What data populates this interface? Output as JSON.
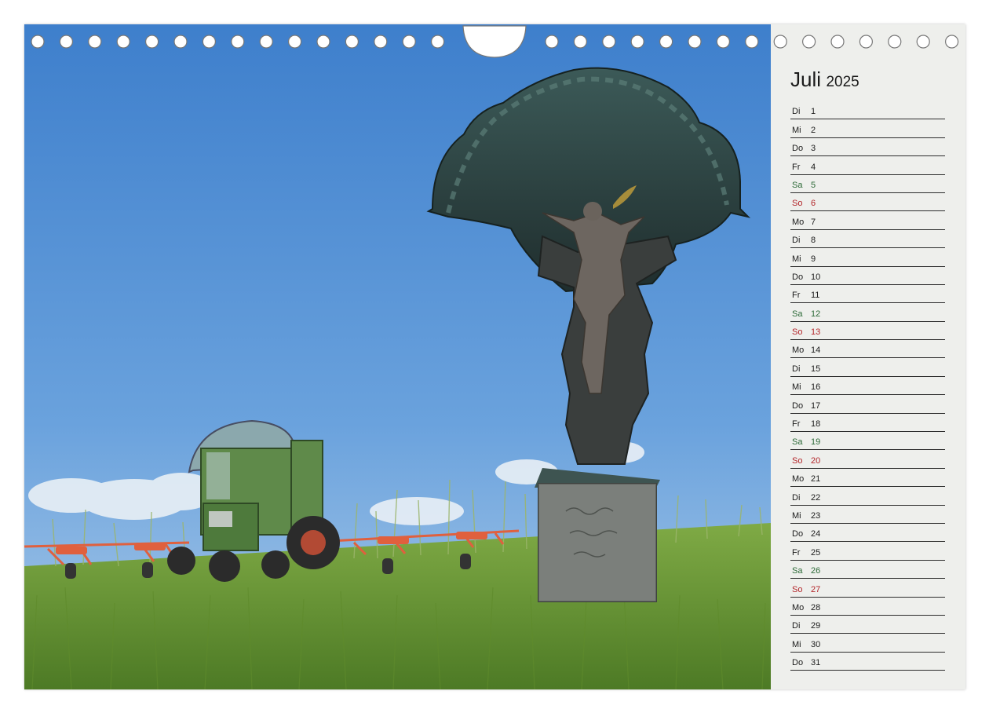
{
  "calendar": {
    "month": "Juli",
    "year": "2025",
    "days": [
      {
        "wd": "Di",
        "d": "1",
        "type": "weekday"
      },
      {
        "wd": "Mi",
        "d": "2",
        "type": "weekday"
      },
      {
        "wd": "Do",
        "d": "3",
        "type": "weekday"
      },
      {
        "wd": "Fr",
        "d": "4",
        "type": "weekday"
      },
      {
        "wd": "Sa",
        "d": "5",
        "type": "sat"
      },
      {
        "wd": "So",
        "d": "6",
        "type": "sun"
      },
      {
        "wd": "Mo",
        "d": "7",
        "type": "weekday"
      },
      {
        "wd": "Di",
        "d": "8",
        "type": "weekday"
      },
      {
        "wd": "Mi",
        "d": "9",
        "type": "weekday"
      },
      {
        "wd": "Do",
        "d": "10",
        "type": "weekday"
      },
      {
        "wd": "Fr",
        "d": "11",
        "type": "weekday"
      },
      {
        "wd": "Sa",
        "d": "12",
        "type": "sat"
      },
      {
        "wd": "So",
        "d": "13",
        "type": "sun"
      },
      {
        "wd": "Mo",
        "d": "14",
        "type": "weekday"
      },
      {
        "wd": "Di",
        "d": "15",
        "type": "weekday"
      },
      {
        "wd": "Mi",
        "d": "16",
        "type": "weekday"
      },
      {
        "wd": "Do",
        "d": "17",
        "type": "weekday"
      },
      {
        "wd": "Fr",
        "d": "18",
        "type": "weekday"
      },
      {
        "wd": "Sa",
        "d": "19",
        "type": "sat"
      },
      {
        "wd": "So",
        "d": "20",
        "type": "sun"
      },
      {
        "wd": "Mo",
        "d": "21",
        "type": "weekday"
      },
      {
        "wd": "Di",
        "d": "22",
        "type": "weekday"
      },
      {
        "wd": "Mi",
        "d": "23",
        "type": "weekday"
      },
      {
        "wd": "Do",
        "d": "24",
        "type": "weekday"
      },
      {
        "wd": "Fr",
        "d": "25",
        "type": "weekday"
      },
      {
        "wd": "Sa",
        "d": "26",
        "type": "sat"
      },
      {
        "wd": "So",
        "d": "27",
        "type": "sun"
      },
      {
        "wd": "Mo",
        "d": "28",
        "type": "weekday"
      },
      {
        "wd": "Di",
        "d": "29",
        "type": "weekday"
      },
      {
        "wd": "Mi",
        "d": "30",
        "type": "weekday"
      },
      {
        "wd": "Do",
        "d": "31",
        "type": "weekday"
      }
    ]
  },
  "colors": {
    "weekday": "#1b1b1b",
    "saturday": "#2d6a38",
    "sunday": "#b3262a",
    "sky": "#4f8fd3",
    "grass": "#6f9a3a",
    "panel": "#eeefec"
  },
  "photo": {
    "subject": "wayside-crucifix-with-tractor-and-hay-tedder",
    "stone_inscription": "Gelobt sei Jesus Christus"
  }
}
